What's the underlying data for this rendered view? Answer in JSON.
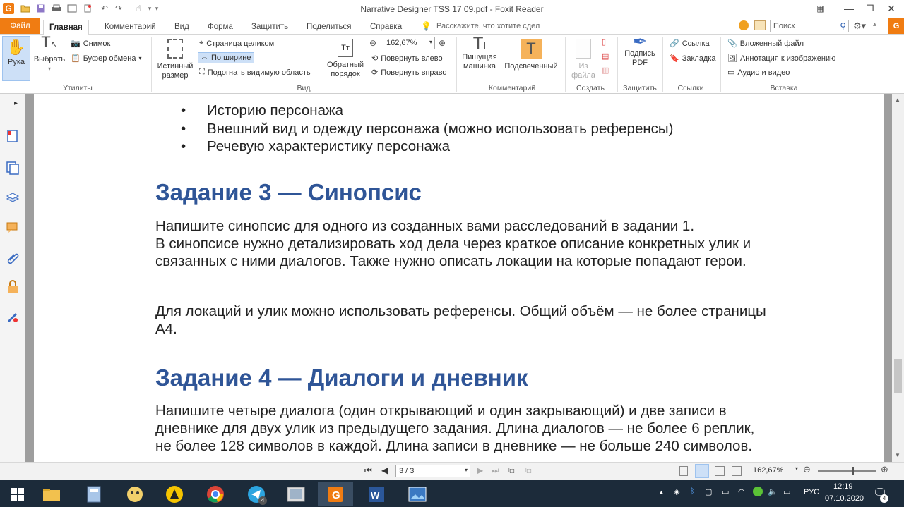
{
  "window": {
    "title": "Narrative Designer TSS 17 09.pdf - Foxit Reader"
  },
  "tabs": [
    "Файл",
    "Главная",
    "Комментарий",
    "Вид",
    "Форма",
    "Защитить",
    "Поделиться",
    "Справка"
  ],
  "tell_me": "Расскажите, что хотите сдел",
  "search": {
    "placeholder": "Поиск"
  },
  "ribbon": {
    "hand": "Рука",
    "select": "Выбрать",
    "snapshot": "Снимок",
    "clipboard": "Буфер обмена",
    "group_utilities": "Утилиты",
    "actual_size_1": "Истинный",
    "actual_size_2": "размер",
    "fit_page": "Страница целиком",
    "fit_width": "По ширине",
    "fit_visible": "Подогнать видимую область",
    "reverse_1": "Обратный",
    "reverse_2": "порядок",
    "zoom_value": "162,67%",
    "rotate_left": "Повернуть влево",
    "rotate_right": "Повернуть вправо",
    "group_view": "Вид",
    "typewriter_1": "Пишущая",
    "typewriter_2": "машинка",
    "highlight": "Подсвеченный",
    "group_comment": "Комментарий",
    "from_file_1": "Из",
    "from_file_2": "файла",
    "group_create": "Создать",
    "sign_1": "Подпись",
    "sign_2": "PDF",
    "group_protect": "Защитить",
    "link": "Ссылка",
    "bookmark": "Закладка",
    "group_links": "Ссылки",
    "attachment": "Вложенный файл",
    "image_annotation": "Аннотация к изображению",
    "audio_video": "Аудио и видео",
    "group_insert": "Вставка"
  },
  "doc": {
    "bullets": [
      "Историю персонажа",
      "Внешний вид и одежду персонажа (можно использовать референсы)",
      "Речевую характеристику персонажа"
    ],
    "h3": "Задание 3 — Синопсис",
    "p3a": "Напишите синопсис для одного из созданных вами расследований в задании 1.",
    "p3b": "В синопсисе нужно детализировать ход дела через краткое описание конкретных улик и",
    "p3c": "связанных с ними диалогов. Также нужно описать локации на которые попадают герои.",
    "p3d": "Для локаций и улик можно использовать референсы. Общий объём — не более страницы",
    "p3e": "А4.",
    "h4": "Задание 4 — Диалоги и дневник",
    "p4a": "Напишите четыре диалога (один открывающий и один закрывающий) и две записи в",
    "p4b": "дневнике для двух улик из предыдущего задания. Длина диалогов — не более 6 реплик,",
    "p4c": "не более 128 символов в каждой. Длина записи в дневнике — не больше 240 символов."
  },
  "status": {
    "page": "3 / 3",
    "zoom": "162,67%"
  },
  "taskbar": {
    "telegram_badge": "4",
    "lang": "РУС",
    "time": "12:19",
    "date": "07.10.2020",
    "notif": "4"
  }
}
